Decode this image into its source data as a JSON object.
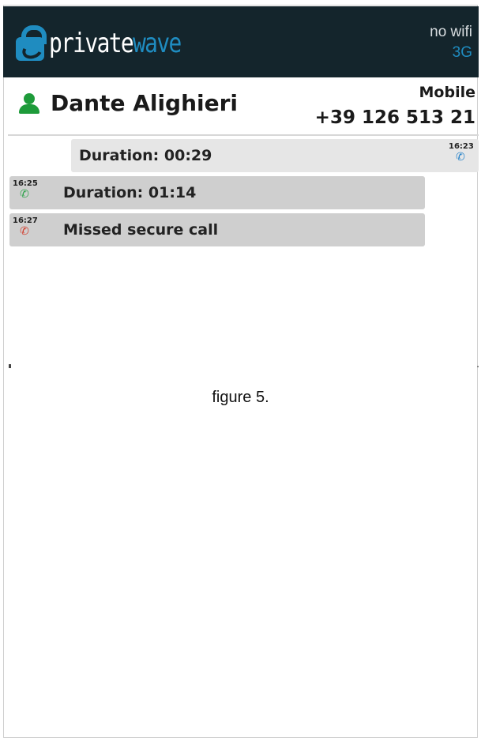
{
  "app": {
    "brand_part1": "private",
    "brand_part2": "wave",
    "network_wifi": "no wifi",
    "network_cell": "3G"
  },
  "contact": {
    "name": "Dante Alighieri",
    "phone_type": "Mobile",
    "phone_number": "+39 126 513 21"
  },
  "calls": [
    {
      "direction": "outgoing",
      "time": "16:23",
      "text": "Duration:  00:29",
      "icon": "outgoing-call-icon",
      "color": "#1f7fc8"
    },
    {
      "direction": "incoming",
      "time": "16:25",
      "text": "Duration:  01:14",
      "icon": "incoming-call-icon",
      "color": "#2aa248"
    },
    {
      "direction": "missed",
      "time": "16:27",
      "text": "Missed secure call",
      "icon": "missed-call-icon",
      "color": "#d23a2a"
    }
  ],
  "caption": "figure 5.",
  "colors": {
    "header_bg": "#14252c",
    "accent_blue": "#1f8cc0",
    "contact_green": "#1e9b3a"
  }
}
